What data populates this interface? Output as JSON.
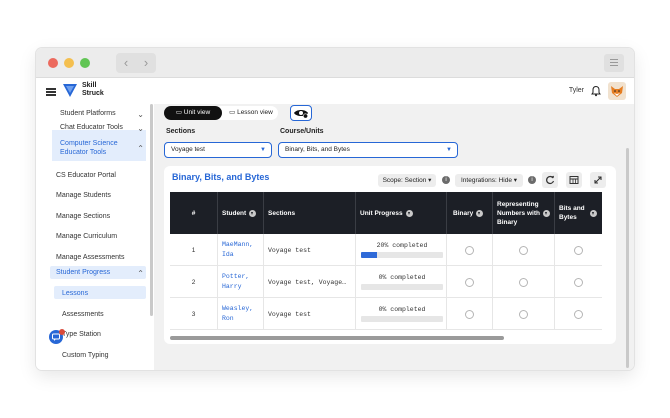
{
  "app": {
    "brand_line1": "Skill",
    "brand_line2": "Struck",
    "user_name": "Tyler"
  },
  "sidebar": {
    "items": [
      {
        "label": "Student Platforms",
        "chevron": "⌄"
      },
      {
        "label": "Chat Educator Tools",
        "chevron": "⌄"
      },
      {
        "label": "Computer Science Educator Tools",
        "chevron": "⌃"
      },
      {
        "label": "CS Educator Portal"
      },
      {
        "label": "Manage Students"
      },
      {
        "label": "Manage Sections"
      },
      {
        "label": "Manage Curriculum"
      },
      {
        "label": "Manage Assessments"
      },
      {
        "label": "Student Progress",
        "chevron": "⌃"
      },
      {
        "label": "Lessons"
      },
      {
        "label": "Assessments"
      },
      {
        "label": "Type Station"
      },
      {
        "label": "Custom Typing"
      }
    ],
    "badge_count": "2"
  },
  "view_toggle": {
    "unit_view": "Unit view",
    "lesson_view": "Lesson view"
  },
  "filters": {
    "sections_label": "Sections",
    "sections_value": "Voyage test",
    "course_label": "Course/Units",
    "course_value": "Binary, Bits, and Bytes"
  },
  "card": {
    "title": "Binary, Bits, and Bytes",
    "scope_label": "Scope: Section",
    "integrations_label": "Integrations: Hide",
    "info_glyph": "i",
    "refresh_icon": "refresh-icon",
    "table_icon": "table-icon",
    "expand_icon": "expand-icon"
  },
  "table": {
    "headers": {
      "num": "#",
      "student": "Student",
      "sections": "Sections",
      "unit_progress": "Unit Progress",
      "binary": "Binary",
      "representing": "Representing Numbers with Binary",
      "bits": "Bits and Bytes"
    },
    "rows": [
      {
        "num": "1",
        "student_line1": "MaeMann,",
        "student_line2": "Ida",
        "sections": "Voyage test",
        "progress_text": "20% completed",
        "progress": 0.2
      },
      {
        "num": "2",
        "student_line1": "Potter,",
        "student_line2": "Harry",
        "sections": "Voyage test, Voyage…",
        "progress_text": "0% completed",
        "progress": 0
      },
      {
        "num": "3",
        "student_line1": "Weasley,",
        "student_line2": "Ron",
        "sections": "Voyage test",
        "progress_text": "0% completed",
        "progress": 0
      }
    ]
  }
}
